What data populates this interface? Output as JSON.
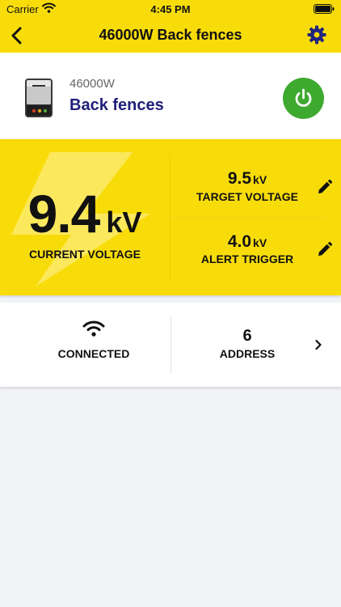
{
  "status_bar": {
    "carrier": "Carrier",
    "time": "4:45 PM"
  },
  "nav": {
    "title": "46000W Back fences"
  },
  "device": {
    "model": "46000W",
    "name": "Back fences"
  },
  "current_voltage": {
    "value": "9.4",
    "unit": "kV",
    "label": "CURRENT VOLTAGE"
  },
  "target_voltage": {
    "value": "9.5",
    "unit": "kV",
    "label": "TARGET VOLTAGE"
  },
  "alert_trigger": {
    "value": "4.0",
    "unit": "kV",
    "label": "ALERT TRIGGER"
  },
  "connection": {
    "label": "CONNECTED"
  },
  "address": {
    "value": "6",
    "label": "ADDRESS"
  },
  "colors": {
    "accent": "#f8dc0a",
    "power": "#3ea92f",
    "device_name": "#20207a"
  },
  "icons": [
    "wifi-icon",
    "battery-icon",
    "back-icon",
    "gear-icon",
    "fence-energizer-icon",
    "power-icon",
    "lightning-bolt-icon",
    "pencil-icon",
    "chevron-right-icon"
  ]
}
